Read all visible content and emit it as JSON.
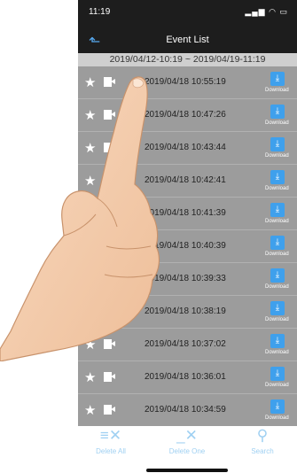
{
  "status": {
    "time": "11:19",
    "signal": "▂▄▆",
    "wifi": "◠",
    "battery": "▭"
  },
  "nav": {
    "back_icon": "back-arrow-icon",
    "title": "Event List"
  },
  "range": "2019/04/12-10:19 ~ 2019/04/19-11:19",
  "rows": [
    {
      "timestamp": "2019/04/18  10:55:19",
      "download_label": "Download"
    },
    {
      "timestamp": "2019/04/18  10:47:26",
      "download_label": "Download"
    },
    {
      "timestamp": "2019/04/18  10:43:44",
      "download_label": "Download"
    },
    {
      "timestamp": "2019/04/18  10:42:41",
      "download_label": "Download"
    },
    {
      "timestamp": "2019/04/18  10:41:39",
      "download_label": "Download"
    },
    {
      "timestamp": "2019/04/18  10:40:39",
      "download_label": "Download"
    },
    {
      "timestamp": "2019/04/18  10:39:33",
      "download_label": "Download"
    },
    {
      "timestamp": "2019/04/18  10:38:19",
      "download_label": "Download"
    },
    {
      "timestamp": "2019/04/18  10:37:02",
      "download_label": "Download"
    },
    {
      "timestamp": "2019/04/18  10:36:01",
      "download_label": "Download"
    },
    {
      "timestamp": "2019/04/18  10:34:59",
      "download_label": "Download"
    }
  ],
  "toolbar": {
    "delete_all": "Delete All",
    "delete_one": "Delete One",
    "search": "Search"
  },
  "colors": {
    "accent": "#3fa0ec",
    "toolbar_text": "#9fd0f2",
    "list_bg": "#9c9c9c",
    "header_bg": "#1d1d1d"
  }
}
